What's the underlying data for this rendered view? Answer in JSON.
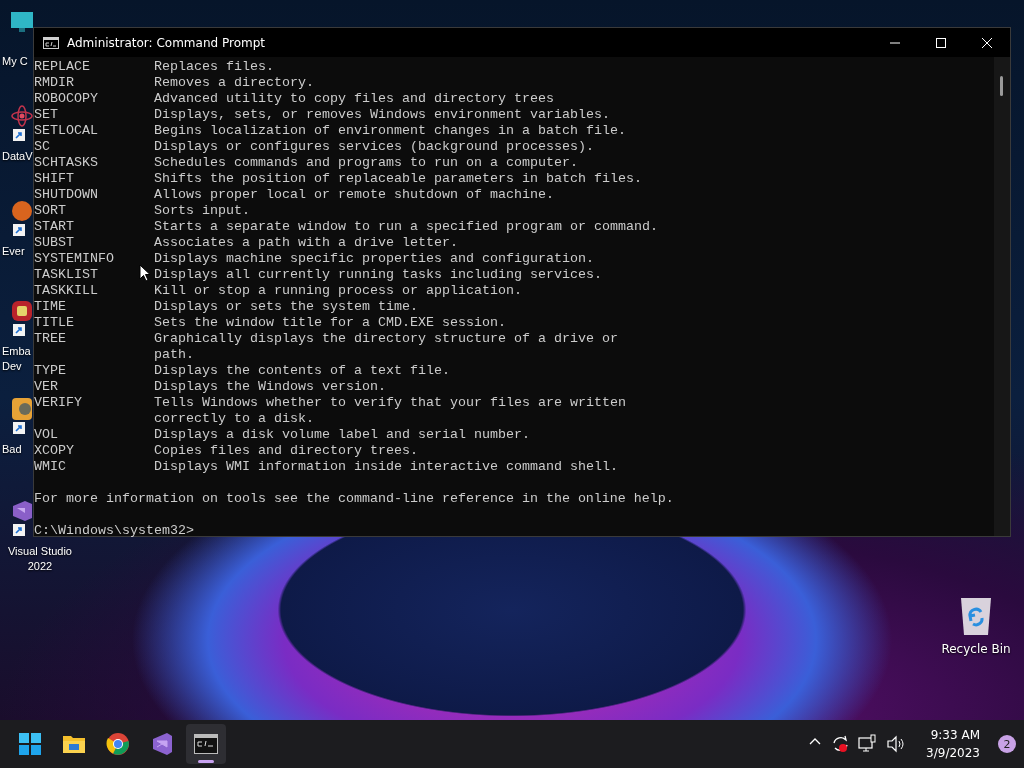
{
  "desktop_icons": [
    {
      "kind": "computer",
      "label": [
        "My C"
      ],
      "shortcut": false
    },
    {
      "kind": "atom",
      "label": [
        "DataV"
      ],
      "shortcut": true
    },
    {
      "kind": "orange",
      "label": [
        "Ever"
      ],
      "shortcut": true
    },
    {
      "kind": "red",
      "label": [
        "Emba",
        "Dev"
      ],
      "shortcut": true
    },
    {
      "kind": "game",
      "label": [
        "Bad"
      ],
      "shortcut": true
    },
    {
      "kind": "vs",
      "label": [
        "Visual Studio",
        "2022"
      ],
      "shortcut": true
    }
  ],
  "recycle_bin": {
    "label": "Recycle Bin"
  },
  "window": {
    "title": "Administrator:  Command Prompt",
    "lines": [
      {
        "command": "REPLACE",
        "description": "Replaces files."
      },
      {
        "command": "RMDIR",
        "description": "Removes a directory."
      },
      {
        "command": "ROBOCOPY",
        "description": "Advanced utility to copy files and directory trees"
      },
      {
        "command": "SET",
        "description": "Displays, sets, or removes Windows environment variables."
      },
      {
        "command": "SETLOCAL",
        "description": "Begins localization of environment changes in a batch file."
      },
      {
        "command": "SC",
        "description": "Displays or configures services (background processes)."
      },
      {
        "command": "SCHTASKS",
        "description": "Schedules commands and programs to run on a computer."
      },
      {
        "command": "SHIFT",
        "description": "Shifts the position of replaceable parameters in batch files."
      },
      {
        "command": "SHUTDOWN",
        "description": "Allows proper local or remote shutdown of machine."
      },
      {
        "command": "SORT",
        "description": "Sorts input."
      },
      {
        "command": "START",
        "description": "Starts a separate window to run a specified program or command."
      },
      {
        "command": "SUBST",
        "description": "Associates a path with a drive letter."
      },
      {
        "command": "SYSTEMINFO",
        "description": "Displays machine specific properties and configuration."
      },
      {
        "command": "TASKLIST",
        "description": "Displays all currently running tasks including services."
      },
      {
        "command": "TASKKILL",
        "description": "Kill or stop a running process or application."
      },
      {
        "command": "TIME",
        "description": "Displays or sets the system time."
      },
      {
        "command": "TITLE",
        "description": "Sets the window title for a CMD.EXE session."
      },
      {
        "command": "TREE",
        "description": "Graphically displays the directory structure of a drive or"
      },
      {
        "description": "path."
      },
      {
        "command": "TYPE",
        "description": "Displays the contents of a text file."
      },
      {
        "command": "VER",
        "description": "Displays the Windows version."
      },
      {
        "command": "VERIFY",
        "description": "Tells Windows whether to verify that your files are written"
      },
      {
        "description": "correctly to a disk."
      },
      {
        "command": "VOL",
        "description": "Displays a disk volume label and serial number."
      },
      {
        "command": "XCOPY",
        "description": "Copies files and directory trees."
      },
      {
        "command": "WMIC",
        "description": "Displays WMI information inside interactive command shell."
      }
    ],
    "footer": "For more information on tools see the command-line reference in the online help.",
    "prompt": "C:\\Windows\\system32>"
  },
  "taskbar": {
    "apps": [
      {
        "kind": "start",
        "active": false
      },
      {
        "kind": "folder",
        "active": false
      },
      {
        "kind": "browser",
        "active": false
      },
      {
        "kind": "vs",
        "active": false
      },
      {
        "kind": "terminal",
        "active": true
      }
    ],
    "tray": {
      "time": "9:33 AM",
      "date": "3/9/2023",
      "notifications": "2"
    }
  }
}
